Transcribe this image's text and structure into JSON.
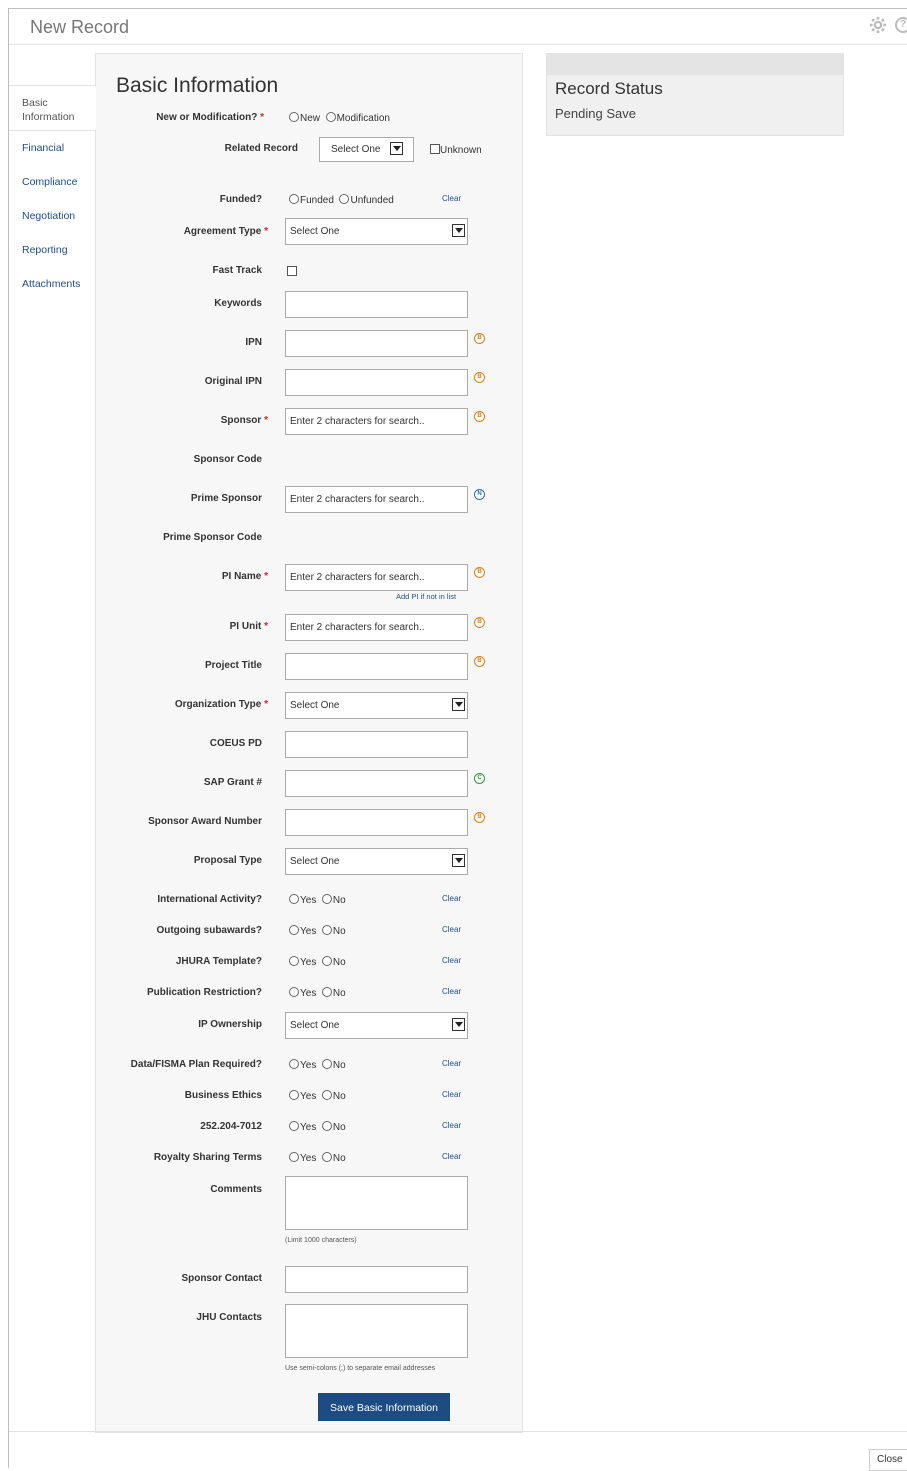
{
  "window": {
    "title": "New Record"
  },
  "sidebar": {
    "items": [
      {
        "label": "Basic Information"
      },
      {
        "label": "Financial"
      },
      {
        "label": "Compliance"
      },
      {
        "label": "Negotiation"
      },
      {
        "label": "Reporting"
      },
      {
        "label": "Attachments"
      }
    ]
  },
  "form": {
    "title": "Basic Information",
    "new_or_mod": {
      "label": "New or Modification?",
      "opt1": "New",
      "opt2": "Modification"
    },
    "related_record": {
      "label": "Related Record",
      "value": "Select One",
      "unknown": "Unknown"
    },
    "funded": {
      "label": "Funded?",
      "opt1": "Funded",
      "opt2": "Unfunded",
      "clear": "Clear"
    },
    "agreement_type": {
      "label": "Agreement Type",
      "value": "Select One"
    },
    "fast_track": {
      "label": "Fast Track"
    },
    "keywords": {
      "label": "Keywords"
    },
    "ipn": {
      "label": "IPN",
      "badge": "B"
    },
    "original_ipn": {
      "label": "Original IPN",
      "badge": "B"
    },
    "sponsor": {
      "label": "Sponsor",
      "placeholder": "Enter 2 characters for search..",
      "badge": "B"
    },
    "sponsor_code": {
      "label": "Sponsor Code"
    },
    "prime_sponsor": {
      "label": "Prime Sponsor",
      "placeholder": "Enter 2 characters for search..",
      "badge": "N"
    },
    "prime_sponsor_code": {
      "label": "Prime Sponsor Code"
    },
    "pi_name": {
      "label": "PI Name",
      "placeholder": "Enter 2 characters for search..",
      "badge": "B",
      "add_link": "Add PI if not in list"
    },
    "pi_unit": {
      "label": "PI Unit",
      "placeholder": "Enter 2 characters for search..",
      "badge": "B"
    },
    "project_title": {
      "label": "Project Title",
      "badge": "B"
    },
    "organization_type": {
      "label": "Organization Type",
      "value": "Select One"
    },
    "coeus_pd": {
      "label": "COEUS PD"
    },
    "sap_grant": {
      "label": "SAP Grant #",
      "badge": "C"
    },
    "sponsor_award_number": {
      "label": "Sponsor Award Number",
      "badge": "B"
    },
    "proposal_type": {
      "label": "Proposal Type",
      "value": "Select One"
    },
    "international_activity": {
      "label": "International Activity?",
      "opt1": "Yes",
      "opt2": "No",
      "clear": "Clear"
    },
    "outgoing_subawards": {
      "label": "Outgoing subawards?",
      "opt1": "Yes",
      "opt2": "No",
      "clear": "Clear"
    },
    "jhura_template": {
      "label": "JHURA Template?",
      "opt1": "Yes",
      "opt2": "No",
      "clear": "Clear"
    },
    "publication_restriction": {
      "label": "Publication Restriction?",
      "opt1": "Yes",
      "opt2": "No",
      "clear": "Clear"
    },
    "ip_ownership": {
      "label": "IP Ownership",
      "value": "Select One"
    },
    "data_fisma": {
      "label": "Data/FISMA Plan Required?",
      "opt1": "Yes",
      "opt2": "No",
      "clear": "Clear"
    },
    "business_ethics": {
      "label": "Business Ethics",
      "opt1": "Yes",
      "opt2": "No",
      "clear": "Clear"
    },
    "far_clause": {
      "label": "252.204-7012",
      "opt1": "Yes",
      "opt2": "No",
      "clear": "Clear"
    },
    "royalty_sharing": {
      "label": "Royalty Sharing Terms",
      "opt1": "Yes",
      "opt2": "No",
      "clear": "Clear"
    },
    "comments": {
      "label": "Comments",
      "hint": "(Limit 1000 characters)"
    },
    "sponsor_contact": {
      "label": "Sponsor Contact"
    },
    "jhu_contacts": {
      "label": "JHU Contacts",
      "hint": "Use semi-colons (;) to separate email addresses"
    },
    "save_label": "Save Basic Information"
  },
  "status": {
    "title": "Record Status",
    "value": "Pending Save"
  },
  "footer": {
    "close_label": "Close"
  },
  "required_mark": "*"
}
